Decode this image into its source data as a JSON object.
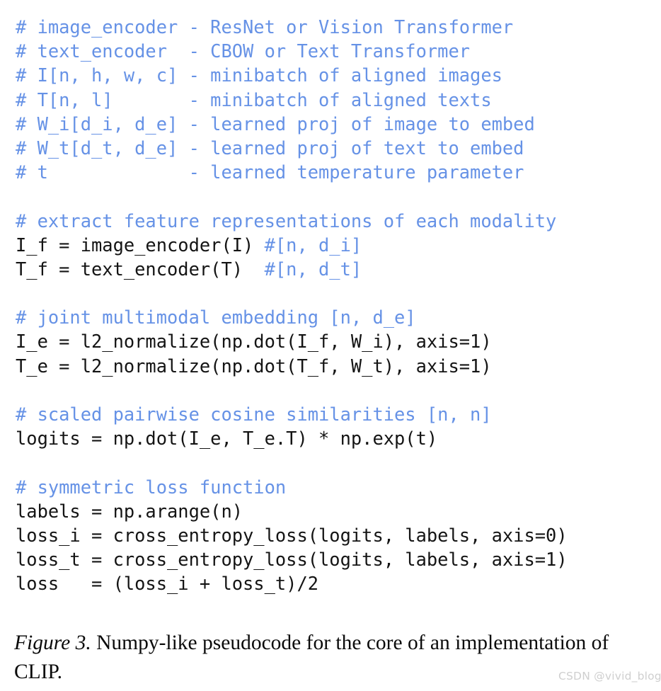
{
  "figure": {
    "background_color": "#ffffff",
    "comment_color": "#6692e6",
    "code_color": "#141414",
    "caption_color": "#0b0b0b",
    "watermark_color": "#cfcfcf"
  },
  "code": {
    "language": "numpy-pseudocode",
    "lines": [
      {
        "type": "comment",
        "comment": "# image_encoder - ResNet or Vision Transformer"
      },
      {
        "type": "comment",
        "comment": "# text_encoder  - CBOW or Text Transformer"
      },
      {
        "type": "comment",
        "comment": "# I[n, h, w, c] - minibatch of aligned images"
      },
      {
        "type": "comment",
        "comment": "# T[n, l]       - minibatch of aligned texts"
      },
      {
        "type": "comment",
        "comment": "# W_i[d_i, d_e] - learned proj of image to embed"
      },
      {
        "type": "comment",
        "comment": "# W_t[d_t, d_e] - learned proj of text to embed"
      },
      {
        "type": "comment",
        "comment": "# t             - learned temperature parameter"
      },
      {
        "type": "blank",
        "code": "",
        "comment": ""
      },
      {
        "type": "comment",
        "comment": "# extract feature representations of each modality"
      },
      {
        "type": "mixed",
        "code": "I_f = image_encoder(I) ",
        "comment": "#[n, d_i]"
      },
      {
        "type": "mixed",
        "code": "T_f = text_encoder(T)  ",
        "comment": "#[n, d_t]"
      },
      {
        "type": "blank",
        "code": "",
        "comment": ""
      },
      {
        "type": "comment",
        "comment": "# joint multimodal embedding [n, d_e]"
      },
      {
        "type": "code",
        "code": "I_e = l2_normalize(np.dot(I_f, W_i), axis=1)"
      },
      {
        "type": "code",
        "code": "T_e = l2_normalize(np.dot(T_f, W_t), axis=1)"
      },
      {
        "type": "blank",
        "code": "",
        "comment": ""
      },
      {
        "type": "comment",
        "comment": "# scaled pairwise cosine similarities [n, n]"
      },
      {
        "type": "code",
        "code": "logits = np.dot(I_e, T_e.T) * np.exp(t)"
      },
      {
        "type": "blank",
        "code": "",
        "comment": ""
      },
      {
        "type": "comment",
        "comment": "# symmetric loss function"
      },
      {
        "type": "code",
        "code": "labels = np.arange(n)"
      },
      {
        "type": "code",
        "code": "loss_i = cross_entropy_loss(logits, labels, axis=0)"
      },
      {
        "type": "code",
        "code": "loss_t = cross_entropy_loss(logits, labels, axis=1)"
      },
      {
        "type": "code",
        "code": "loss   = (loss_i + loss_t)/2"
      }
    ]
  },
  "caption": {
    "label": "Figure 3.",
    "body": " Numpy-like pseudocode for the core of an implementation of CLIP."
  },
  "watermark": {
    "text": "CSDN @vivid_blog"
  }
}
